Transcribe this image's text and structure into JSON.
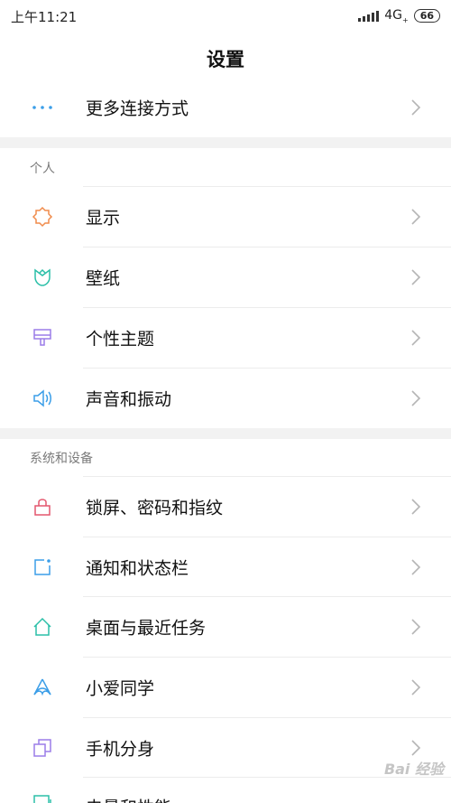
{
  "status": {
    "time": "上午11:21",
    "network": "4G",
    "network_sub": "+",
    "battery": "66"
  },
  "header": {
    "title": "设置"
  },
  "top_item": {
    "label": "更多连接方式",
    "icon": "more-dots-icon",
    "color": "#3b9ee8"
  },
  "sections": [
    {
      "title": "个人",
      "items": [
        {
          "label": "显示",
          "icon": "sun-icon",
          "color": "#f08b4b"
        },
        {
          "label": "壁纸",
          "icon": "tulip-icon",
          "color": "#2bbfa8"
        },
        {
          "label": "个性主题",
          "icon": "brush-icon",
          "color": "#9b7de8"
        },
        {
          "label": "声音和振动",
          "icon": "speaker-icon",
          "color": "#3b9ee8"
        }
      ]
    },
    {
      "title": "系统和设备",
      "items": [
        {
          "label": "锁屏、密码和指纹",
          "icon": "lock-icon",
          "color": "#e4576e"
        },
        {
          "label": "通知和状态栏",
          "icon": "notification-icon",
          "color": "#3b9ee8"
        },
        {
          "label": "桌面与最近任务",
          "icon": "home-icon",
          "color": "#2bbfa8"
        },
        {
          "label": "小爱同学",
          "icon": "xiaoai-icon",
          "color": "#3b9ee8"
        },
        {
          "label": "手机分身",
          "icon": "clone-icon",
          "color": "#9b7de8"
        },
        {
          "label": "电量和性能",
          "icon": "battery-icon",
          "color": "#2bbfa8"
        }
      ]
    }
  ],
  "watermark": "Bai 经验"
}
